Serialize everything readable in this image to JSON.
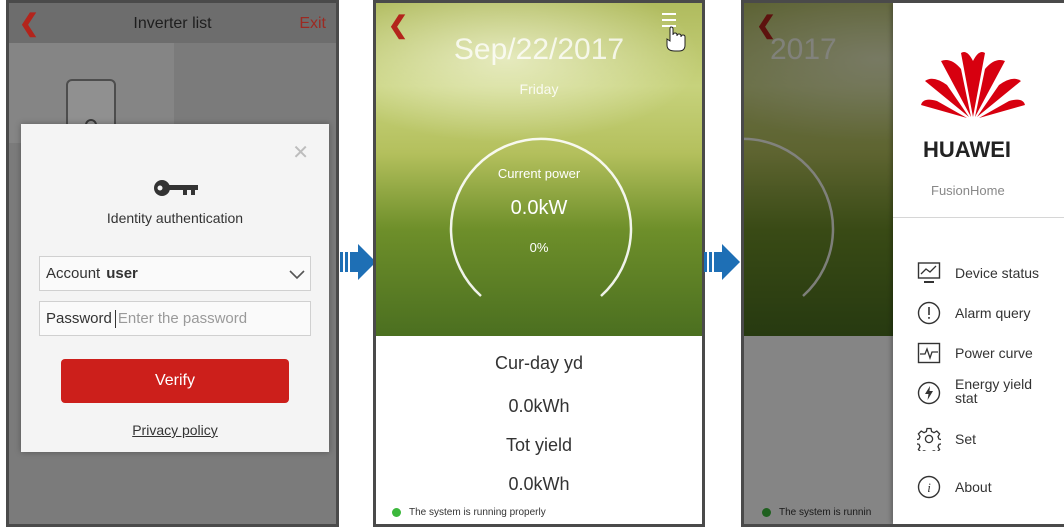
{
  "screen1": {
    "title": "Inverter list",
    "exit": "Exit",
    "dialog": {
      "title": "Identity authentication",
      "account_label": "Account",
      "account_value": "user",
      "password_label": "Password",
      "password_placeholder": "Enter the password",
      "verify": "Verify",
      "privacy": "Privacy policy"
    }
  },
  "screen2": {
    "date": "Sep/22/2017",
    "day": "Friday",
    "gauge_label": "Current power",
    "power": "0.0kW",
    "percent": "0%",
    "day_yield_label": "Cur-day yd",
    "day_yield": "0.0kWh",
    "total_yield_label": "Tot yield",
    "total_yield": "0.0kWh",
    "status": "The system is running properly"
  },
  "screen3": {
    "bg_date": "2017",
    "bg_status": "The system is runnin",
    "brand": "HUAWEI",
    "app_name": "FusionHome",
    "menu": [
      {
        "label": "Device status",
        "icon": "monitor-chart-icon"
      },
      {
        "label": "Alarm query",
        "icon": "alert-circle-icon"
      },
      {
        "label": "Power curve",
        "icon": "pulse-icon"
      },
      {
        "label": "Energy yield stat",
        "icon": "lightning-icon"
      },
      {
        "label": "Set",
        "icon": "gear-icon"
      },
      {
        "label": "About",
        "icon": "info-icon"
      }
    ]
  },
  "colors": {
    "accent_red": "#cc1f1b",
    "status_green": "#3cb83c",
    "arrow_blue": "#1e6fb5"
  }
}
